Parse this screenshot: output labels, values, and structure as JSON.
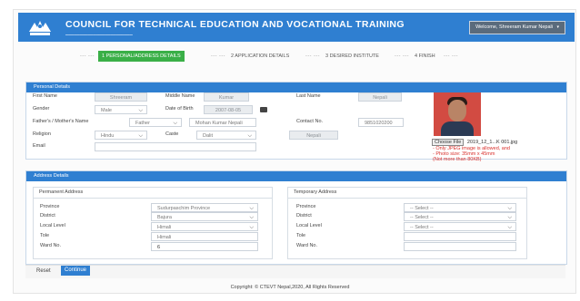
{
  "header": {
    "title": "COUNCIL FOR TECHNICAL EDUCATION AND VOCATIONAL TRAINING",
    "user_menu": "Welcome, Shreeram Kumar Nepali"
  },
  "steps": [
    {
      "label": "1  PERSONAL/ADDRESS DETAILS",
      "active": true
    },
    {
      "label": "2  APPLICATION DETAILS",
      "active": false
    },
    {
      "label": "3  DESIRED INSTITUTE",
      "active": false
    },
    {
      "label": "4  FINISH",
      "active": false
    }
  ],
  "personal": {
    "heading": "Personal Details",
    "first_name_label": "First Name",
    "first_name": "Shreeram",
    "middle_name_label": "Middle Name",
    "middle_name": "Kumar",
    "last_name_label": "Last Name",
    "last_name": "Nepali",
    "gender_label": "Gender",
    "gender": "Male",
    "dob_label": "Date of Birth",
    "dob": "2007-08-05",
    "guardian_label": "Father's / Mother's Name",
    "guardian_relation": "Father",
    "guardian_name": "Mohan Kumar Nepali",
    "contact_label": "Contact No.",
    "contact": "9851020200",
    "religion_label": "Religion",
    "religion": "Hindu",
    "caste_label": "Caste",
    "caste": "Dalit",
    "nationality": "Nepali",
    "email_label": "Email",
    "email": "",
    "choose_file": "Choose File",
    "file_name": "2019_12_1...K 001.jpg",
    "photo_notes": [
      "- Only JPEG image is allowed, and",
      "- Photo size: 35mm x 45mm",
      "  (Not more than 80KB)"
    ]
  },
  "address": {
    "heading": "Address Details",
    "permanent": {
      "heading": "Permanent Address",
      "province_label": "Province",
      "province": "Sudurpaschim Province",
      "district_label": "District",
      "district": "Bajura",
      "local_label": "Local Level",
      "local": "Himali",
      "tole_label": "Tole",
      "tole": "Himali",
      "ward_label": "Ward No.",
      "ward": "6"
    },
    "temporary": {
      "heading": "Temporary Address",
      "province_label": "Province",
      "province": "-- Select --",
      "district_label": "District",
      "district": "-- Select --",
      "local_label": "Local Level",
      "local": "-- Select --",
      "tole_label": "Tole",
      "tole": "",
      "ward_label": "Ward No.",
      "ward": ""
    }
  },
  "actions": {
    "reset": "Reset",
    "continue": "Continue"
  },
  "footer": {
    "copyright": "Copyright: © CTEVT Nepal,2020, All Rights Reserved"
  },
  "colors": {
    "brand_blue": "#2f7fd1",
    "step_active": "#3aaf47",
    "error_red": "#d9302c"
  }
}
